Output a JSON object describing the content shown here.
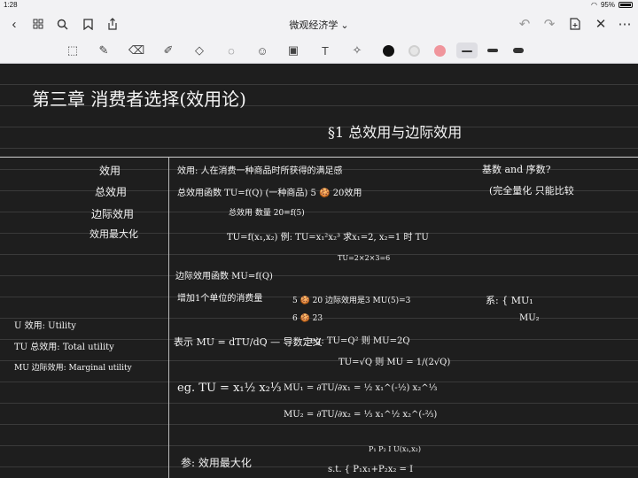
{
  "status": {
    "time": "1:28",
    "battery": "95%"
  },
  "nav": {
    "title": "微观经济学 ⌄"
  },
  "toolbar": {
    "tools": [
      "lasso-icon",
      "pen-icon",
      "eraser-icon",
      "highlighter-icon",
      "shapes-icon",
      "lasso-select-icon",
      "sticker-icon",
      "image-icon",
      "text-icon",
      "laser-icon"
    ],
    "colors": [
      "#111111",
      "#e6e6e6",
      "#f0959c"
    ]
  },
  "notes": {
    "chapter_title": "第三章 消费者选择(效用论)",
    "section_title": "§1 总效用与边际效用",
    "left_terms": [
      "效用",
      "总效用",
      "边际效用",
      "效用最大化"
    ],
    "left_defs": [
      "U  效用: Utility",
      "TU 总效用: Total utility",
      "MU 边际效用: Marginal utility"
    ],
    "r1": "效用: 人在消费一种商品时所获得的满足感",
    "r2": "总效用函数  TU=f(Q)   (一种商品)   5 🍪  20效用",
    "r3": "总效用  数量              20=f(5)",
    "r4": "TU=f(x₁,x₂)      例: TU=x₁²x₂³   求x₁=2, x₂=1 时 TU",
    "r5": "TU=2×2×3=6",
    "r6": "基数 and 序数?",
    "r7": "(完全量化    只能比较",
    "r8": "边际效用函数      MU=f(Q)",
    "r9": "增加1个单位的消费量",
    "r10": "5 🍪  20        边际效用是3     MU(5)=3",
    "r11": "6 🍪  23",
    "r12": "系: { MU₁",
    "r13": "MU₂",
    "r14": "表示   MU = dTU/dQ   — 导数定义",
    "r15": "eg:  TU=Q²  则  MU=2Q",
    "r16": "TU=√Q  则  MU = 1/(2√Q)",
    "r17": "eg. TU = x₁½ x₂⅓",
    "r18": "MU₁ = ∂TU/∂x₁ = ½ x₁^(-½) x₂^⅓",
    "r19": "MU₂ = ∂TU/∂x₂ = ⅓ x₁^½ x₂^(-⅔)",
    "r20": "参: 效用最大化",
    "r21": "P₁ P₂ I  U(x₁,x₂)",
    "r22": "s.t. { P₁x₁+P₂x₂ = I"
  }
}
